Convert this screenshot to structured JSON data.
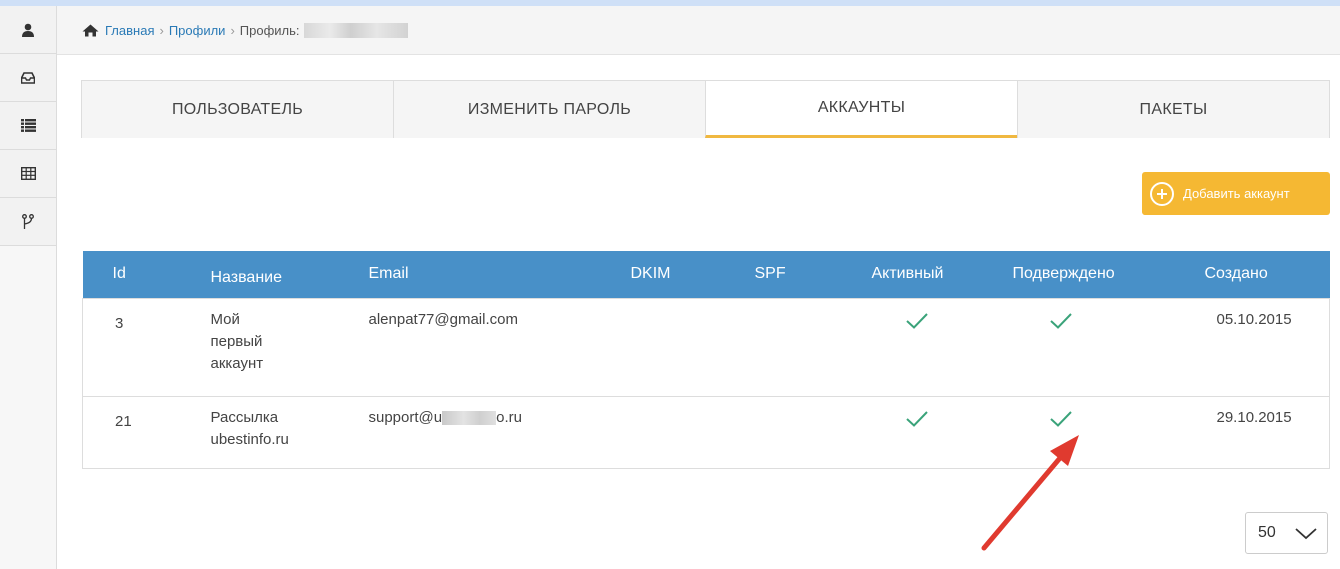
{
  "breadcrumb": {
    "home": "Главная",
    "profiles": "Профили",
    "current": "Профиль:"
  },
  "sidebar": {
    "items": [
      "user-icon",
      "inbox-icon",
      "list-icon",
      "table-icon",
      "branch-icon"
    ]
  },
  "tabs": [
    {
      "label": "ПОЛЬЗОВАТЕЛЬ",
      "active": false
    },
    {
      "label": "ИЗМЕНИТЬ ПАРОЛЬ",
      "active": false
    },
    {
      "label": "АККАУНТЫ",
      "active": true
    },
    {
      "label": "ПАКЕТЫ",
      "active": false
    }
  ],
  "add_button": {
    "label": "Добавить аккаунт"
  },
  "table": {
    "headers": [
      "Id",
      "Название",
      "Email",
      "DKIM",
      "SPF",
      "Активный",
      "Подверждено",
      "Создано"
    ],
    "rows": [
      {
        "id": "3",
        "name_lines": [
          "Мой",
          "первый",
          "аккаунт"
        ],
        "email": "alenpat77@gmail.com",
        "email_prefix": "",
        "email_suffix": "",
        "created": "05.10.2015"
      },
      {
        "id": "21",
        "name_lines": [
          "Рассылка",
          "ubestinfo.ru"
        ],
        "email": "",
        "email_prefix": "support@u",
        "email_suffix": "o.ru",
        "created": "29.10.2015"
      }
    ]
  },
  "pager": {
    "value": "50"
  },
  "colors": {
    "header_blue": "#4890c8",
    "accent_yellow": "#f5b833",
    "check_green": "#3aa37a",
    "arrow_red": "#e03a2f"
  }
}
